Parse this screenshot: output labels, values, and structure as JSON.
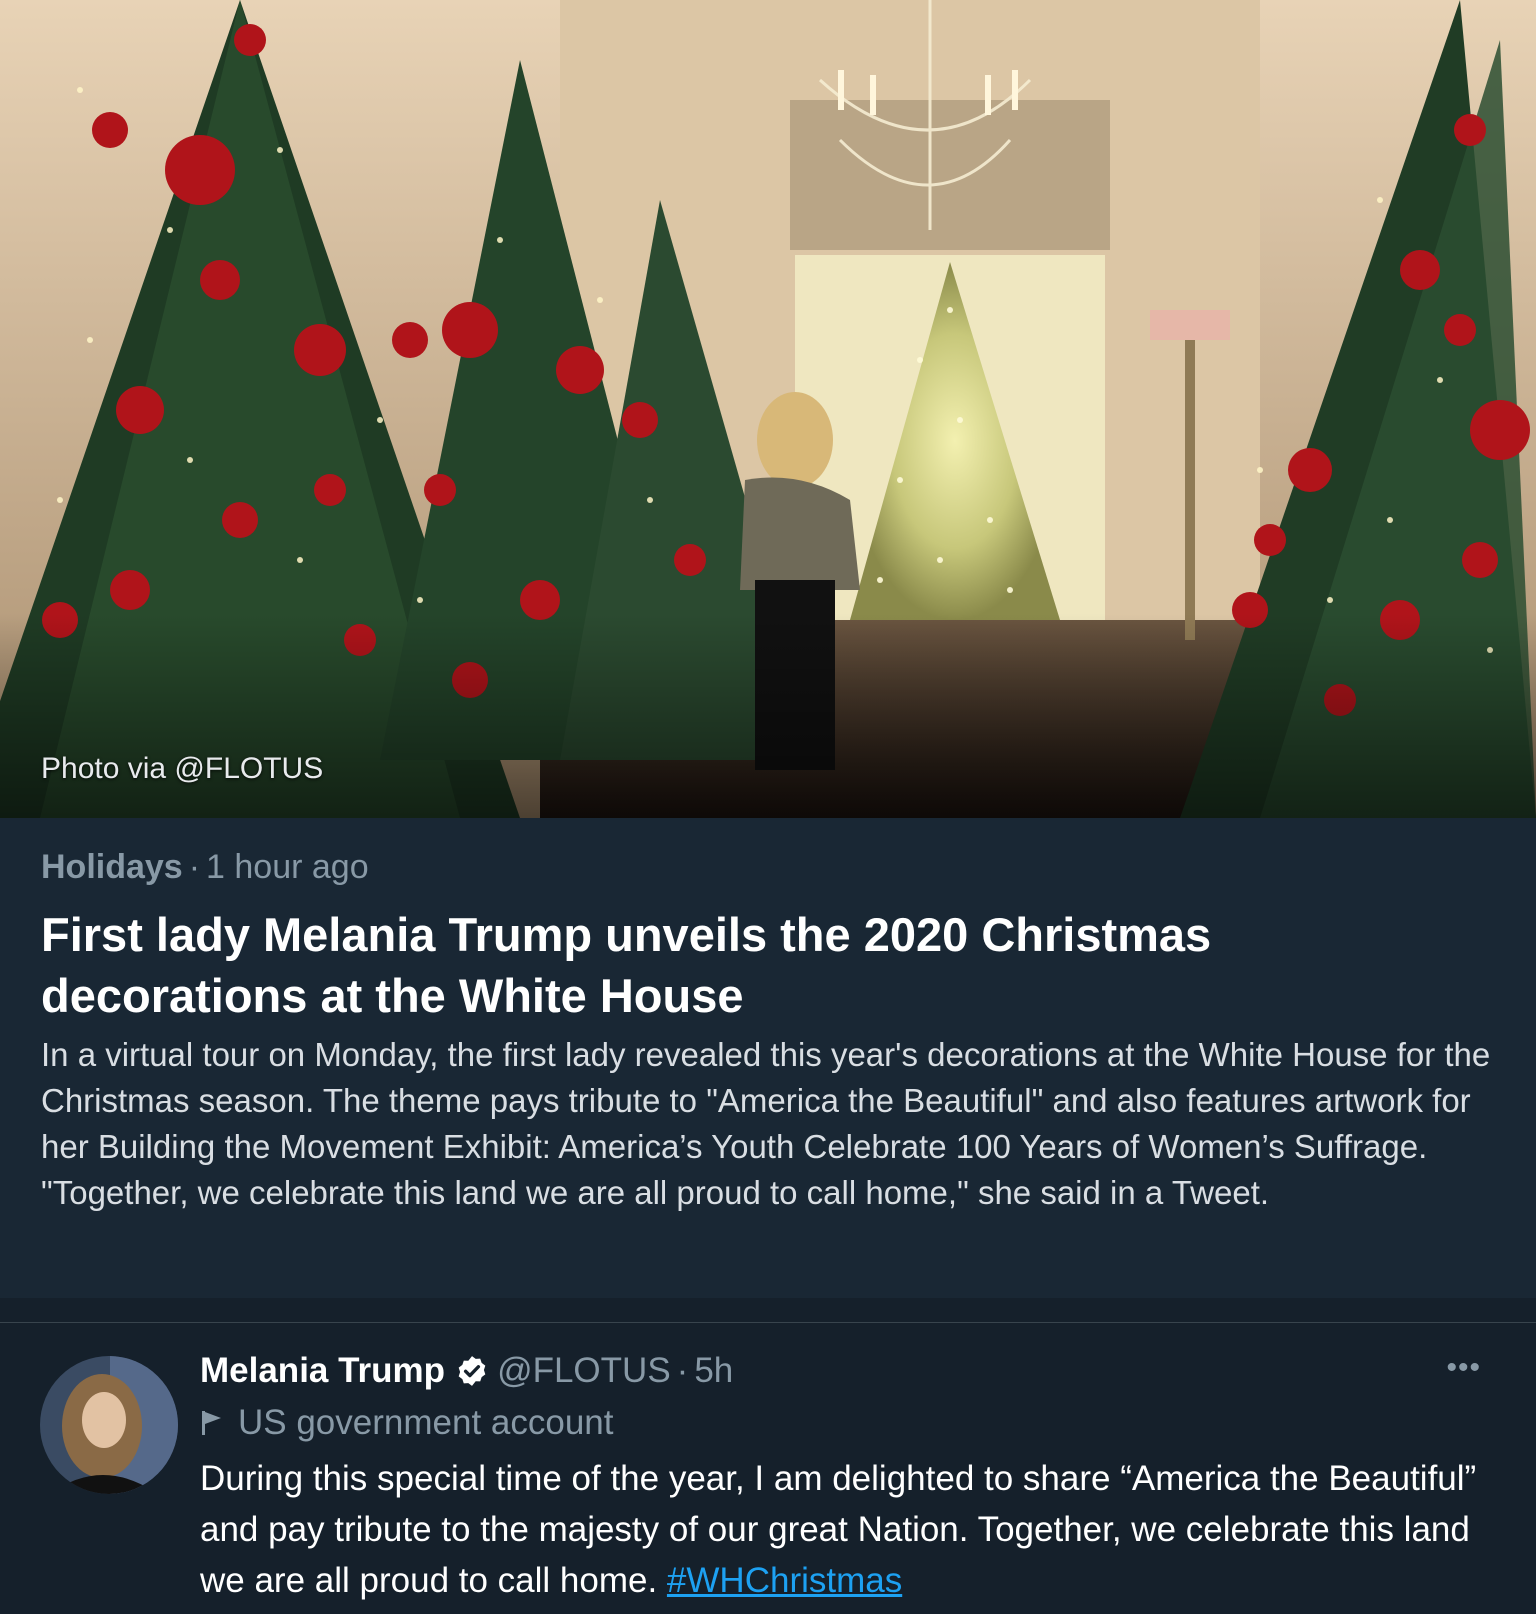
{
  "hero": {
    "image_description": "White House hallway with Christmas trees decorated in red ornaments and a chandelier",
    "photo_credit": "Photo via @FLOTUS"
  },
  "article": {
    "category": "Holidays",
    "separator": "·",
    "time_ago": "1 hour ago",
    "headline": "First lady Melania Trump unveils the 2020 Christmas decorations at the White House",
    "summary": "In a virtual tour on Monday, the first lady revealed this year's decorations at the White House for the Christmas season. The theme pays tribute to \"America the Beautiful\" and also features artwork for her Building the Movement Exhibit: America’s Youth Celebrate 100 Years of Women’s Suffrage. \"Together, we celebrate this land we are all proud to call home,\" she said in a Tweet."
  },
  "tweet": {
    "name": "Melania Trump",
    "handle": "@FLOTUS",
    "separator": "·",
    "time": "5h",
    "more": "•••",
    "account_label": "US government account",
    "text": "During this special time of the year, I am delighted to share “America the Beautiful” and pay tribute to the majesty of our great Nation. Together, we celebrate this land we are all proud to call home. ",
    "hashtag": "#WHChristmas"
  },
  "colors": {
    "background": "#15202b",
    "card": "#192734",
    "secondary_text": "#8899a6",
    "link": "#1da1f2"
  },
  "icons": [
    "verified-badge-icon",
    "flag-icon",
    "more-options-icon"
  ]
}
